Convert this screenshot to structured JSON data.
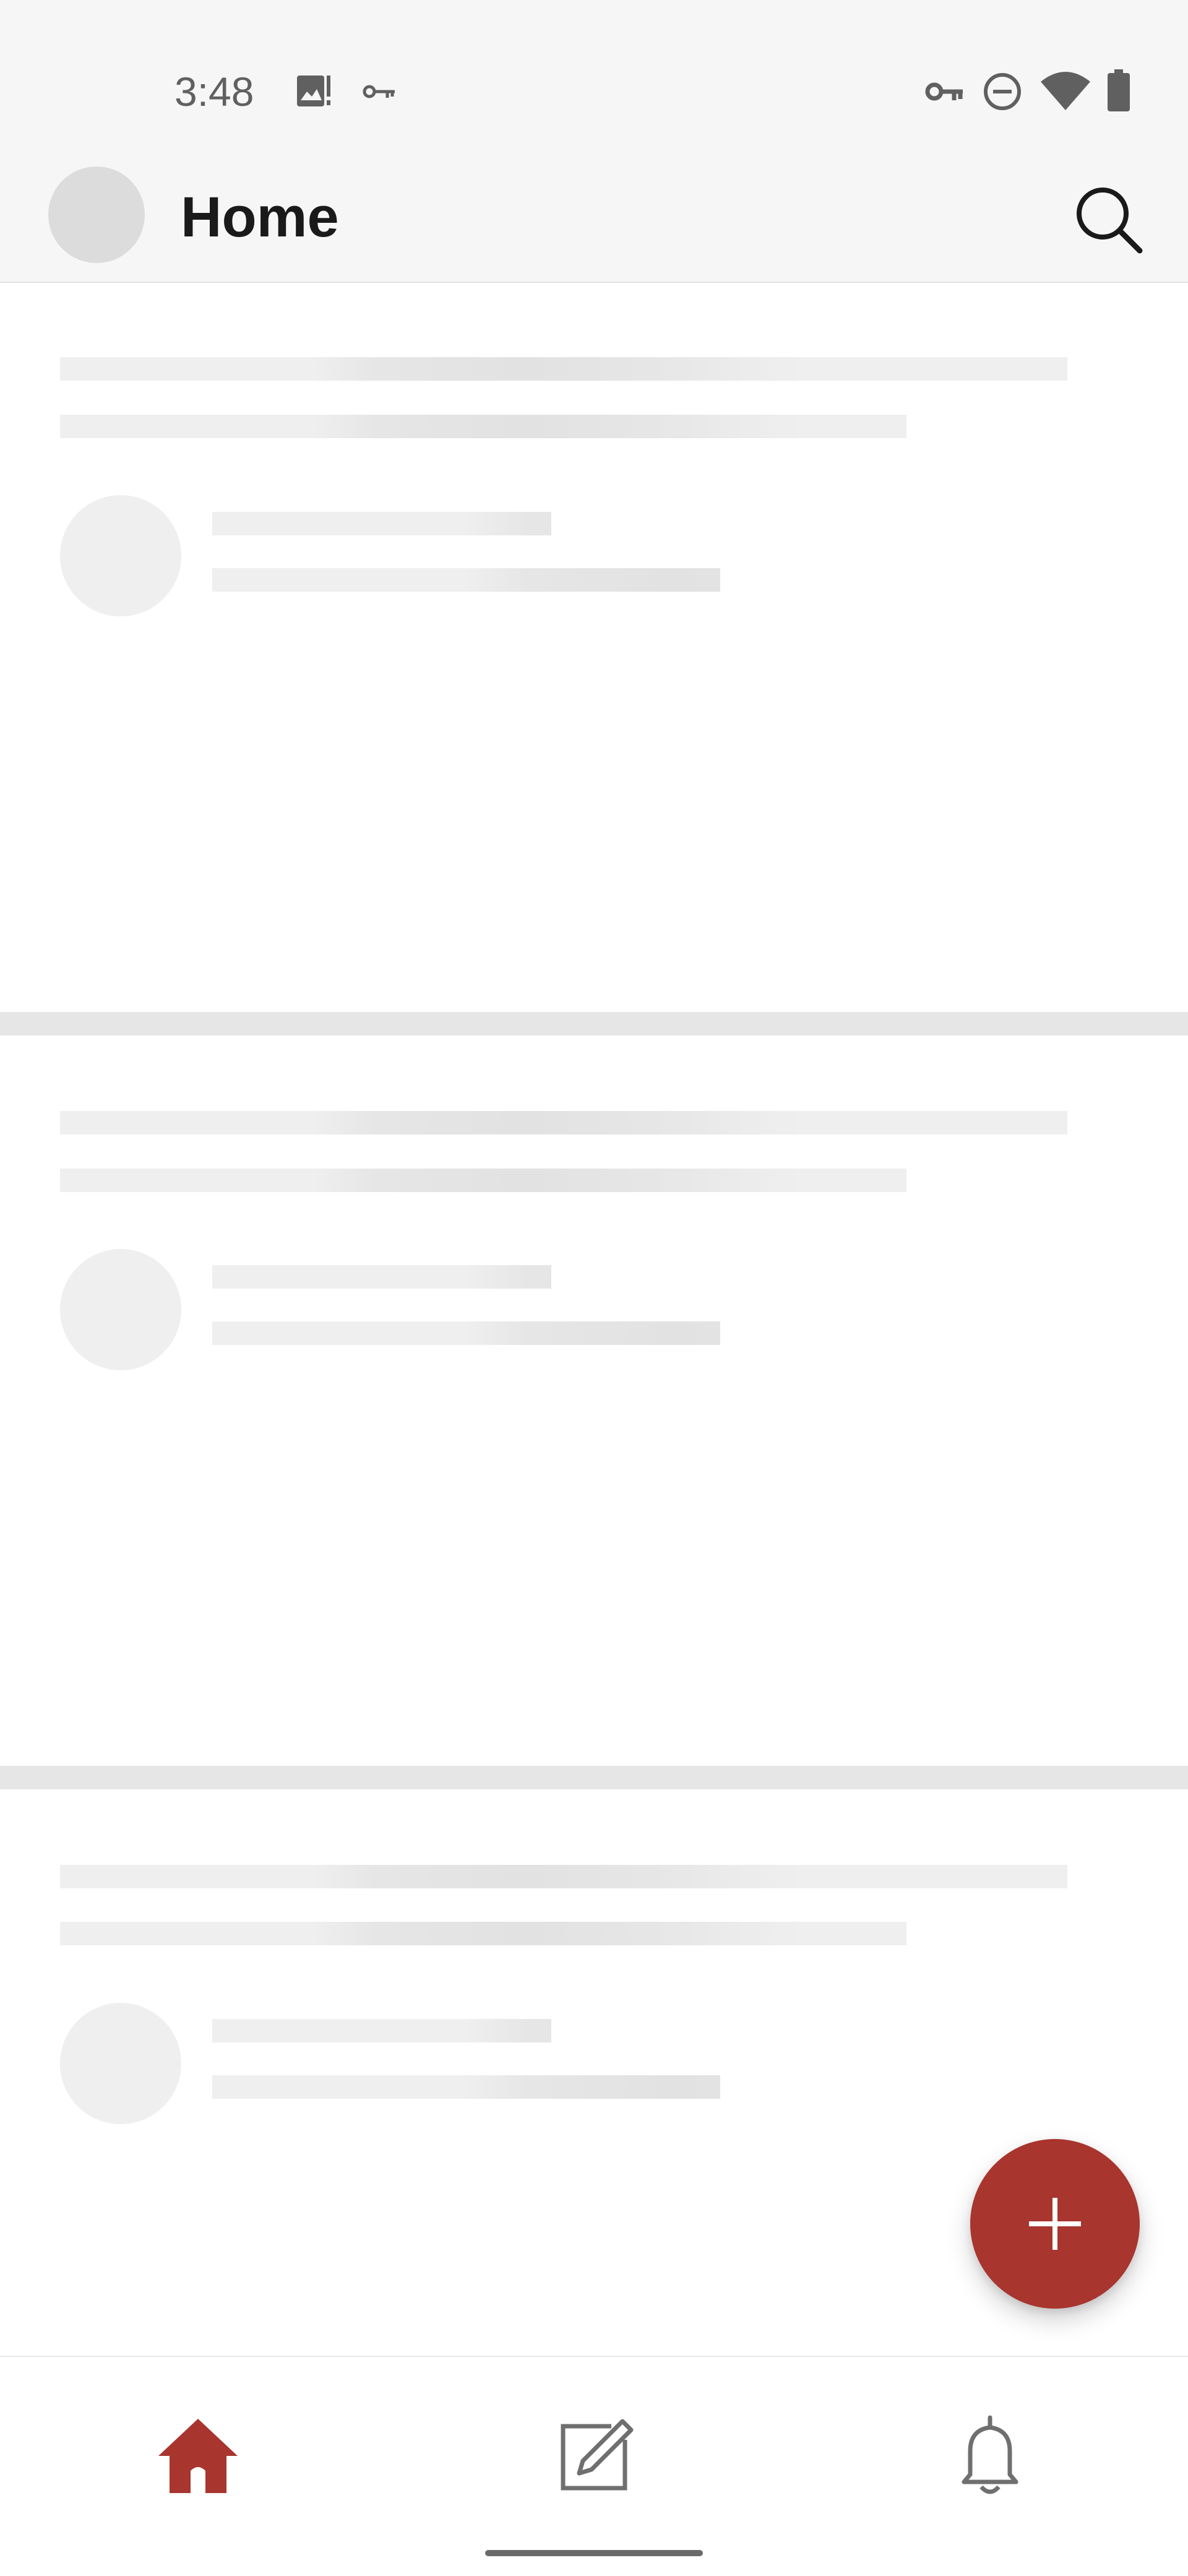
{
  "status_bar": {
    "time": "3:48",
    "left_icons": [
      "image-alert-icon",
      "key-icon"
    ],
    "right_icons": [
      "vpn-key-icon",
      "do-not-disturb-icon",
      "wifi-icon",
      "battery-icon"
    ]
  },
  "app_bar": {
    "title": "Home",
    "avatar_icon": "avatar",
    "search_icon": "search-icon"
  },
  "feed": {
    "state": "loading-skeleton",
    "placeholder_cards": 3
  },
  "fab": {
    "icon": "plus-icon",
    "color": "#a8352e"
  },
  "bottom_nav": {
    "items": [
      {
        "icon": "home-icon",
        "active": true
      },
      {
        "icon": "compose-icon",
        "active": false
      },
      {
        "icon": "bell-icon",
        "active": false
      }
    ],
    "active_color": "#a8352e",
    "inactive_color": "#6f6f6f"
  },
  "colors": {
    "accent": "#a8352e",
    "skeleton": "#efefef",
    "appbar_bg": "#f6f6f6"
  }
}
